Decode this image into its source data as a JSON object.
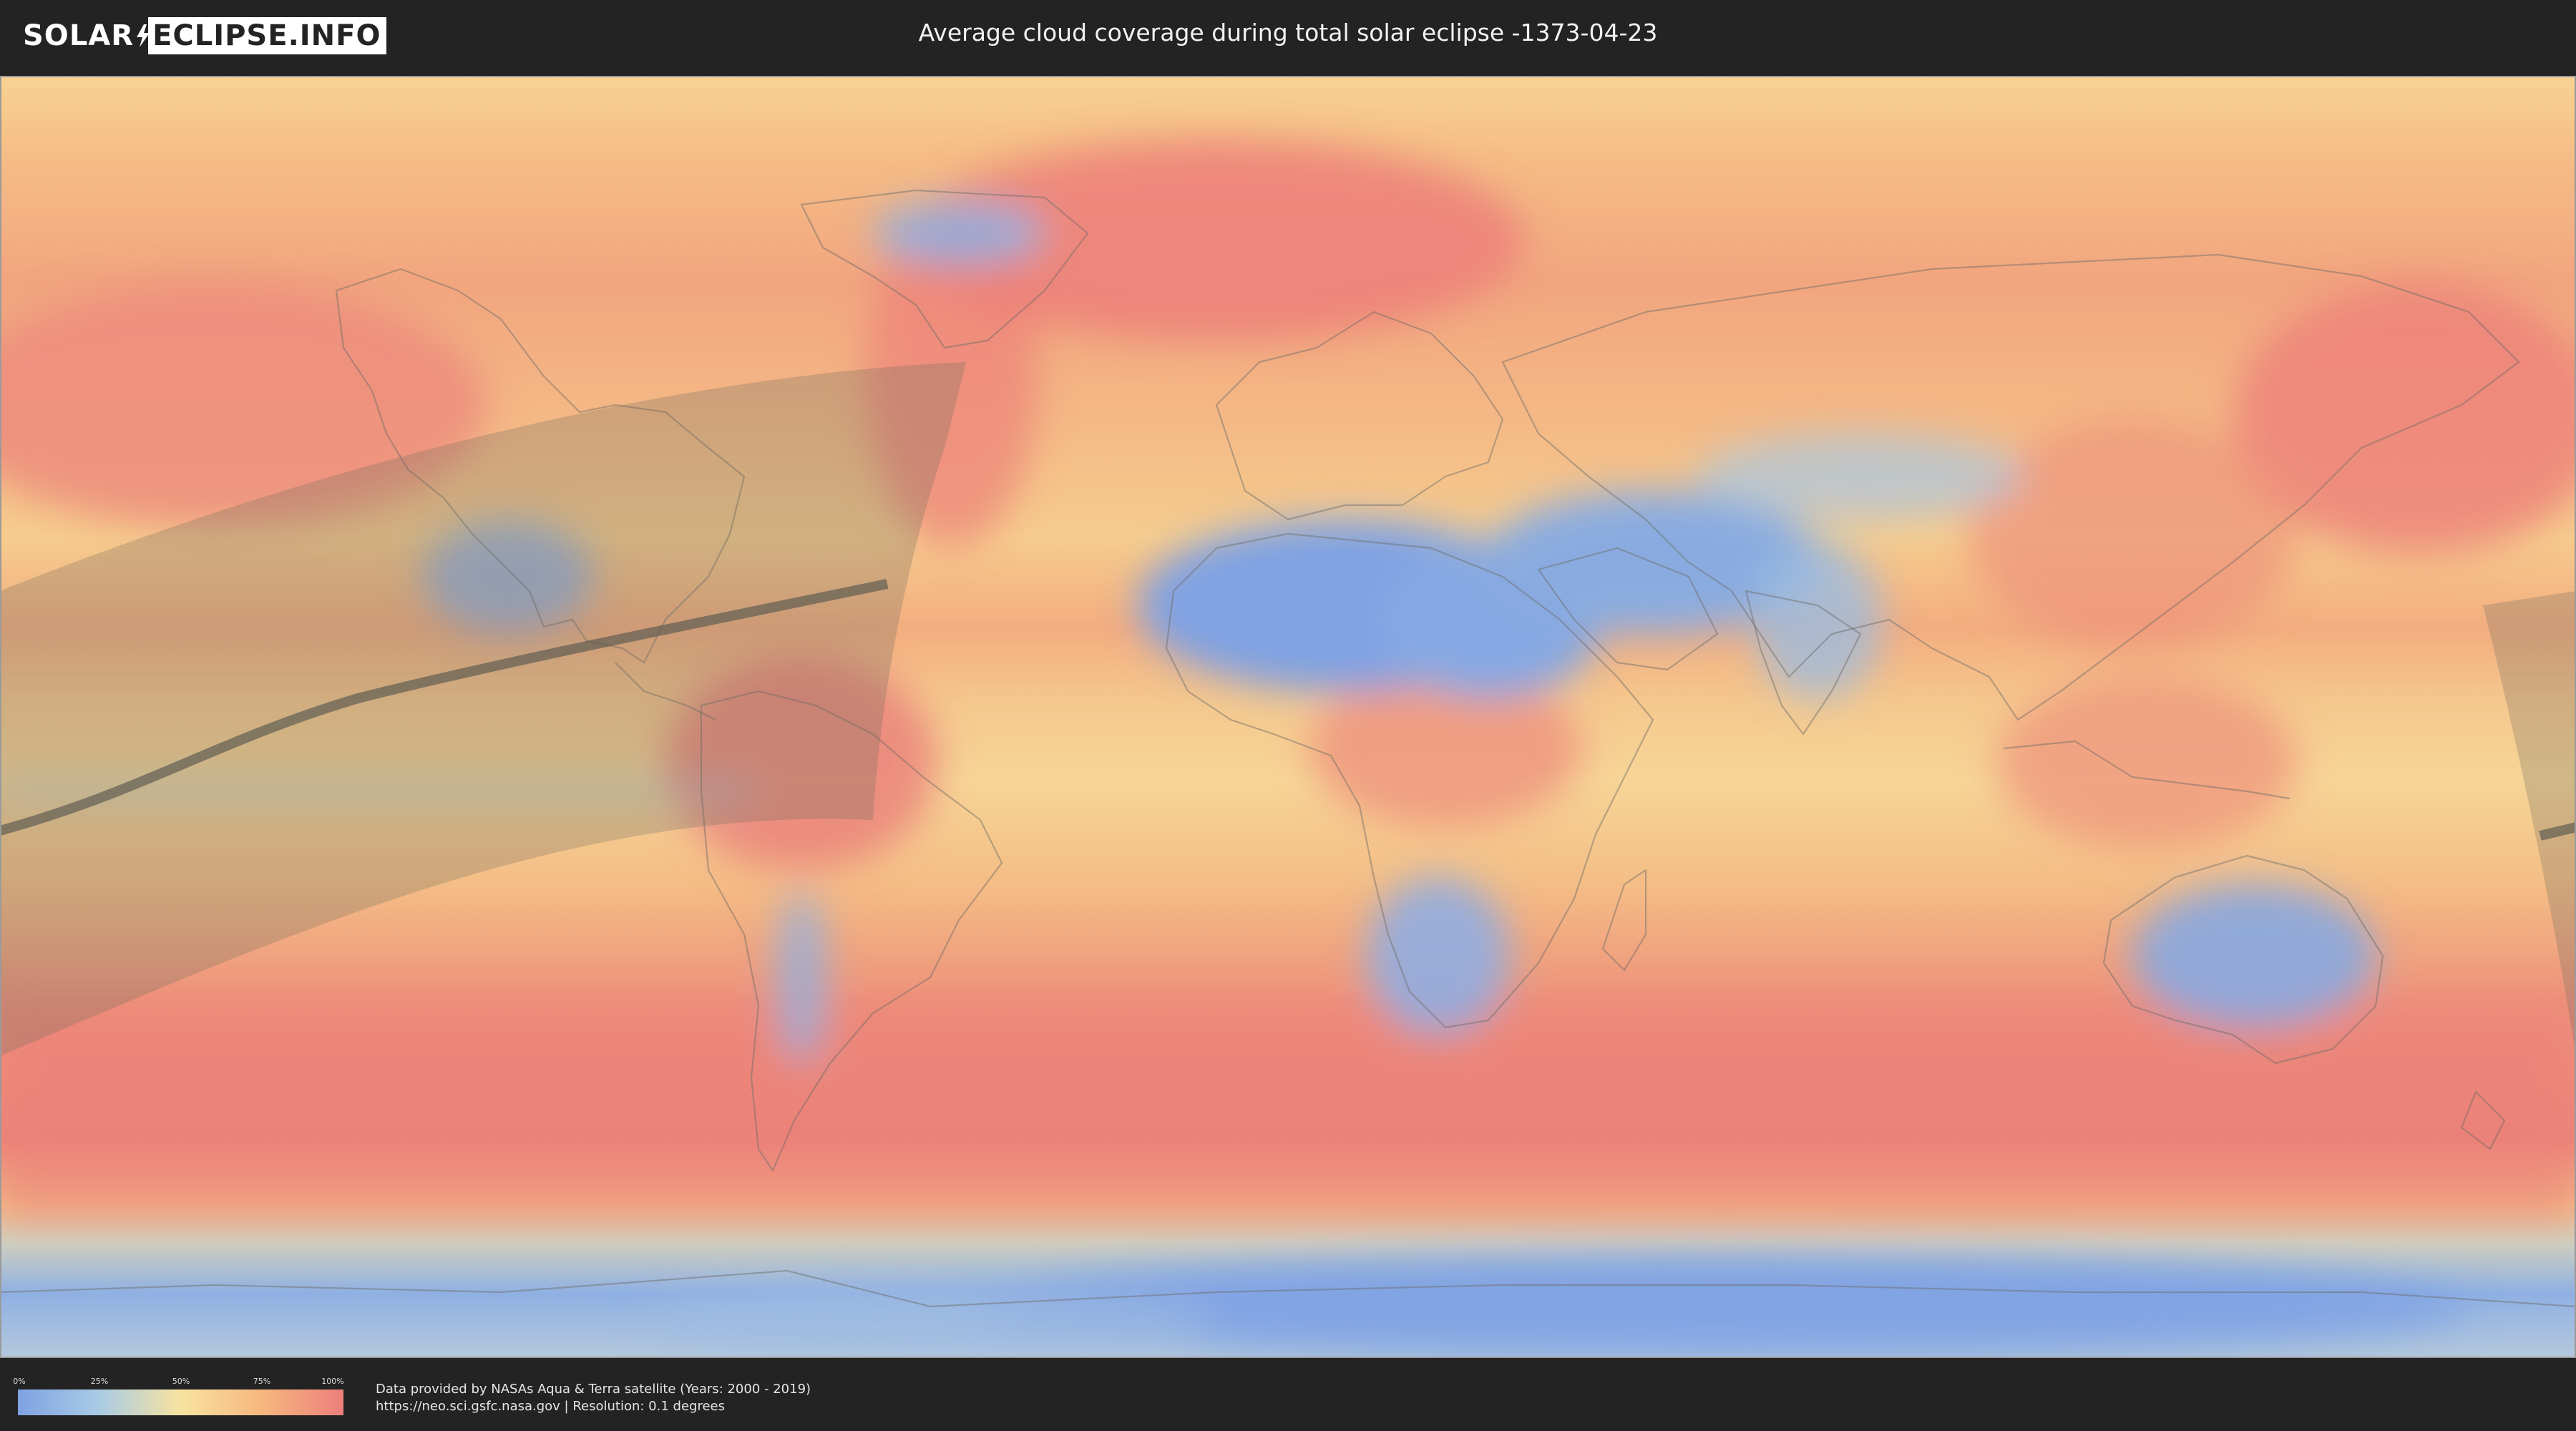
{
  "header": {
    "logo_left": "SOLAR",
    "logo_right": "ECLIPSE.INFO",
    "title": "Average cloud coverage during total solar eclipse -1373-04-23"
  },
  "map": {
    "layer": "average cloud coverage",
    "projection": "equirectangular world",
    "colors": {
      "clear": "#7fa2e3",
      "low": "#a9cbe4",
      "mid": "#f8e3a0",
      "high": "#f6b77e",
      "overcast": "#ec7f7b",
      "eclipse_overlay": "#6f6a5e",
      "central_line": "#5f5c52"
    }
  },
  "legend": {
    "ticks": [
      "0%",
      "25%",
      "50%",
      "75%",
      "100%"
    ],
    "colors": [
      "#7fa2e3",
      "#a9cbe4",
      "#f8e3a0",
      "#f6b77e",
      "#ec7f7b"
    ]
  },
  "footer": {
    "source_line": "Data provided by NASAs Aqua & Terra satellite (Years: 2000 - 2019)",
    "url_line": "https://neo.sci.gsfc.nasa.gov | Resolution: 0.1 degrees"
  }
}
